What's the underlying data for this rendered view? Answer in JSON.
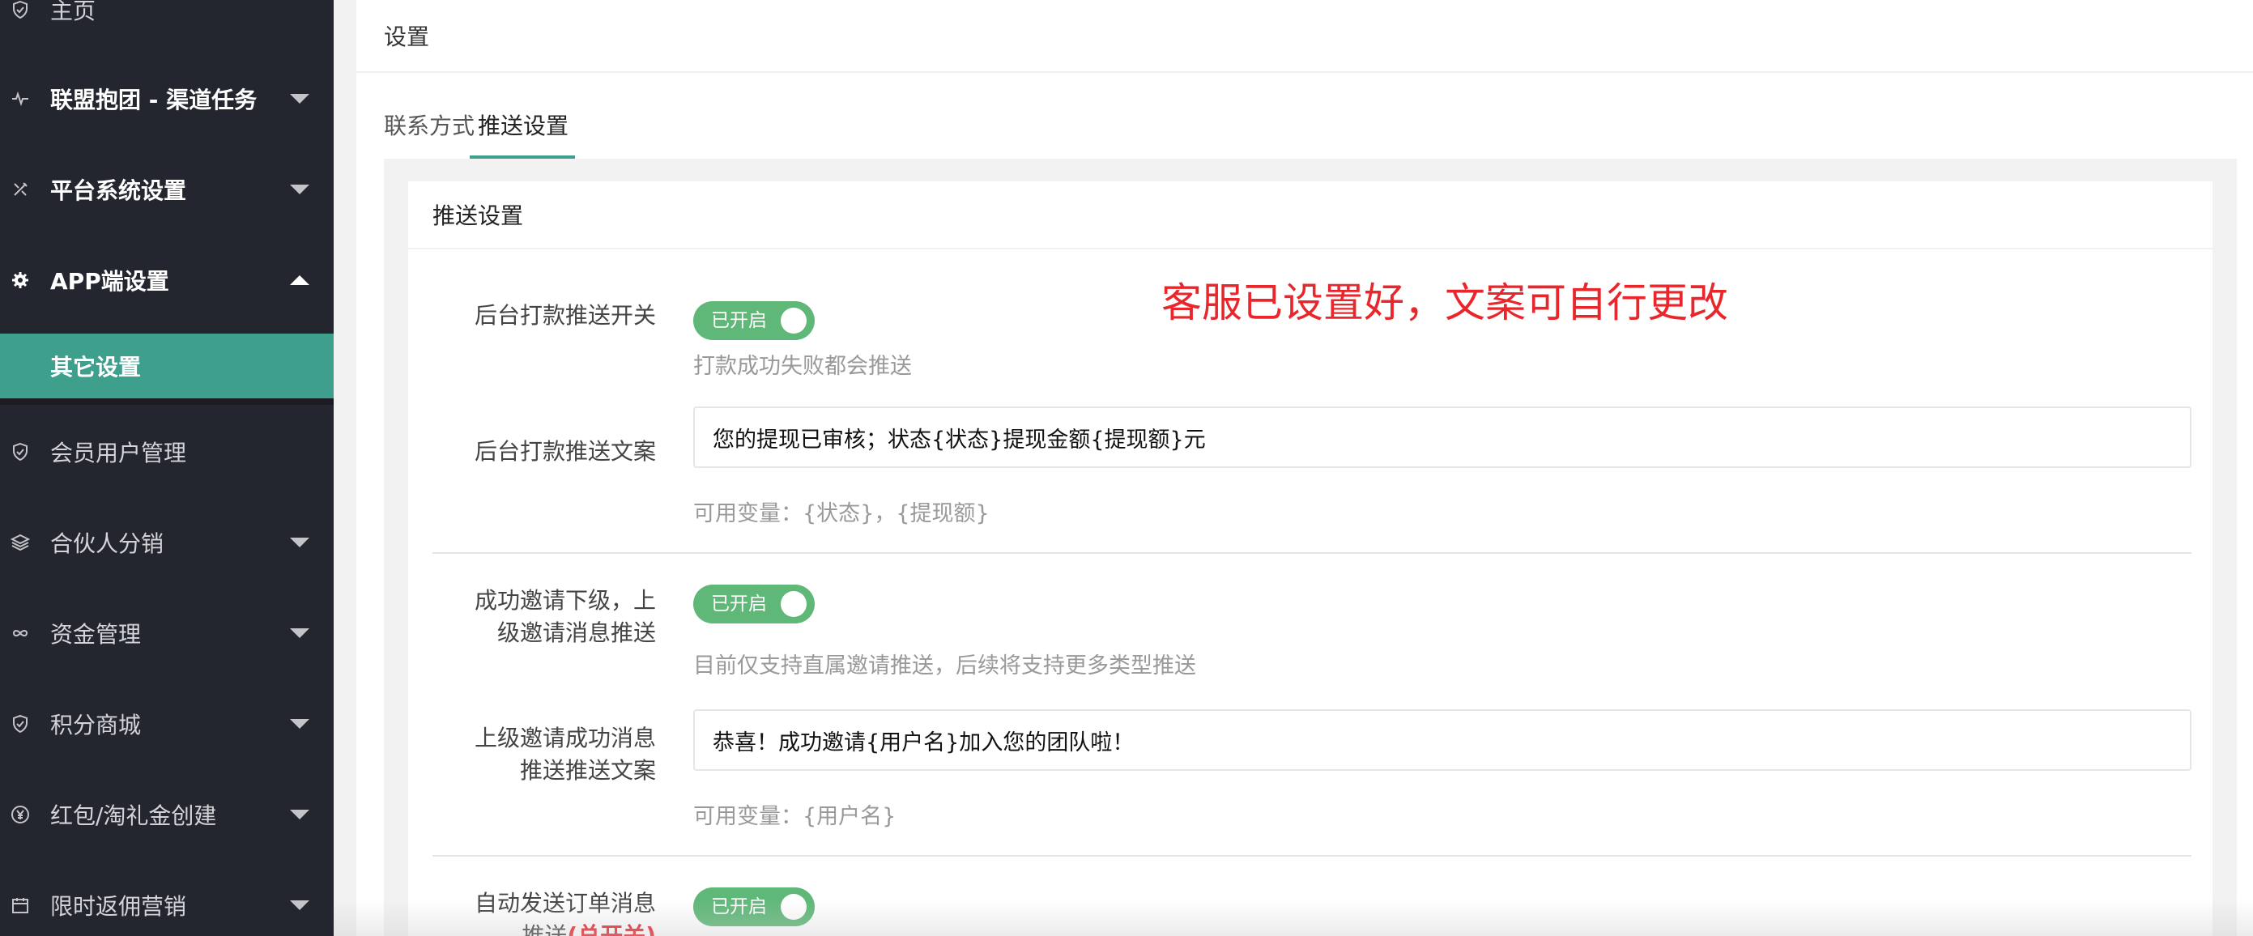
{
  "sidebar": {
    "items": [
      {
        "label": "主页",
        "icon": "shield-icon"
      },
      {
        "label": "联盟抱团 - 渠道任务",
        "icon": "pulse-icon"
      },
      {
        "label": "平台系统设置",
        "icon": "tools-icon"
      },
      {
        "label": "APP端设置",
        "icon": "gear-icon"
      },
      {
        "label": "会员用户管理",
        "icon": "shield-icon"
      },
      {
        "label": "合伙人分销",
        "icon": "layers-icon"
      },
      {
        "label": "资金管理",
        "icon": "infinity-icon"
      },
      {
        "label": "积分商城",
        "icon": "shield-icon"
      },
      {
        "label": "红包/淘礼金创建",
        "icon": "yen-icon"
      },
      {
        "label": "限时返佣营销",
        "icon": "calendar-icon"
      }
    ],
    "sub_item": {
      "label": "其它设置"
    },
    "active_color": "#3f9f8d"
  },
  "header": {
    "title": "设置"
  },
  "tabs": [
    {
      "label": "联系方式"
    },
    {
      "label": "推送设置"
    }
  ],
  "panel": {
    "title": "推送设置",
    "fields": [
      {
        "label": "后台打款推送开关",
        "switch_text": "已开启",
        "hint": "打款成功失败都会推送"
      },
      {
        "label": "后台打款推送文案",
        "value": "您的提现已审核；状态{状态}提现金额{提现额}元",
        "hint": "可用变量：{状态}，{提现额}"
      },
      {
        "label_line1": "成功邀请下级，上",
        "label_line2": "级邀请消息推送",
        "switch_text": "已开启",
        "hint": "目前仅支持直属邀请推送，后续将支持更多类型推送"
      },
      {
        "label_line1": "上级邀请成功消息",
        "label_line2": "推送推送文案",
        "value": "恭喜！成功邀请{用户名}加入您的团队啦！",
        "hint": "可用变量：{用户名}"
      },
      {
        "label_line1": "自动发送订单消息",
        "label_line2": "推送",
        "label_red": "(总开关)",
        "switch_text": "已开启"
      }
    ]
  },
  "annotation": "客服已设置好，文案可自行更改",
  "colors": {
    "switch_on": "#5fb878",
    "annotation": "#e8262b",
    "sidebar_bg": "#23262e"
  }
}
